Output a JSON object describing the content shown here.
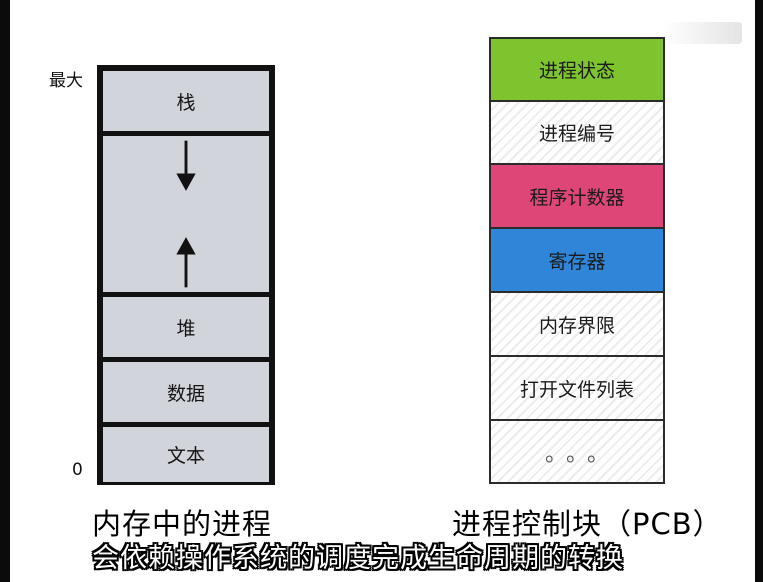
{
  "memory": {
    "label_max": "最大",
    "label_zero": "0",
    "segments": {
      "stack": "栈",
      "heap": "堆",
      "data": "数据",
      "text": "文本"
    },
    "caption": "内存中的进程"
  },
  "pcb": {
    "cells": [
      {
        "label": "进程状态",
        "color": "#7dc42f"
      },
      {
        "label": "进程编号",
        "color": "hatched"
      },
      {
        "label": "程序计数器",
        "color": "#de4678"
      },
      {
        "label": "寄存器",
        "color": "#2f86d8"
      },
      {
        "label": "内存界限",
        "color": "hatched"
      },
      {
        "label": "打开文件列表",
        "color": "hatched"
      },
      {
        "label": "。。。",
        "color": "hatched"
      }
    ],
    "caption": "进程控制块（PCB）"
  },
  "subtitle": "会依赖操作系统的调度完成生命周期的转换",
  "colors": {
    "segment_fill": "#d2d4db",
    "border": "#111111"
  },
  "icons": [
    "arrow-down-icon",
    "arrow-up-icon"
  ]
}
